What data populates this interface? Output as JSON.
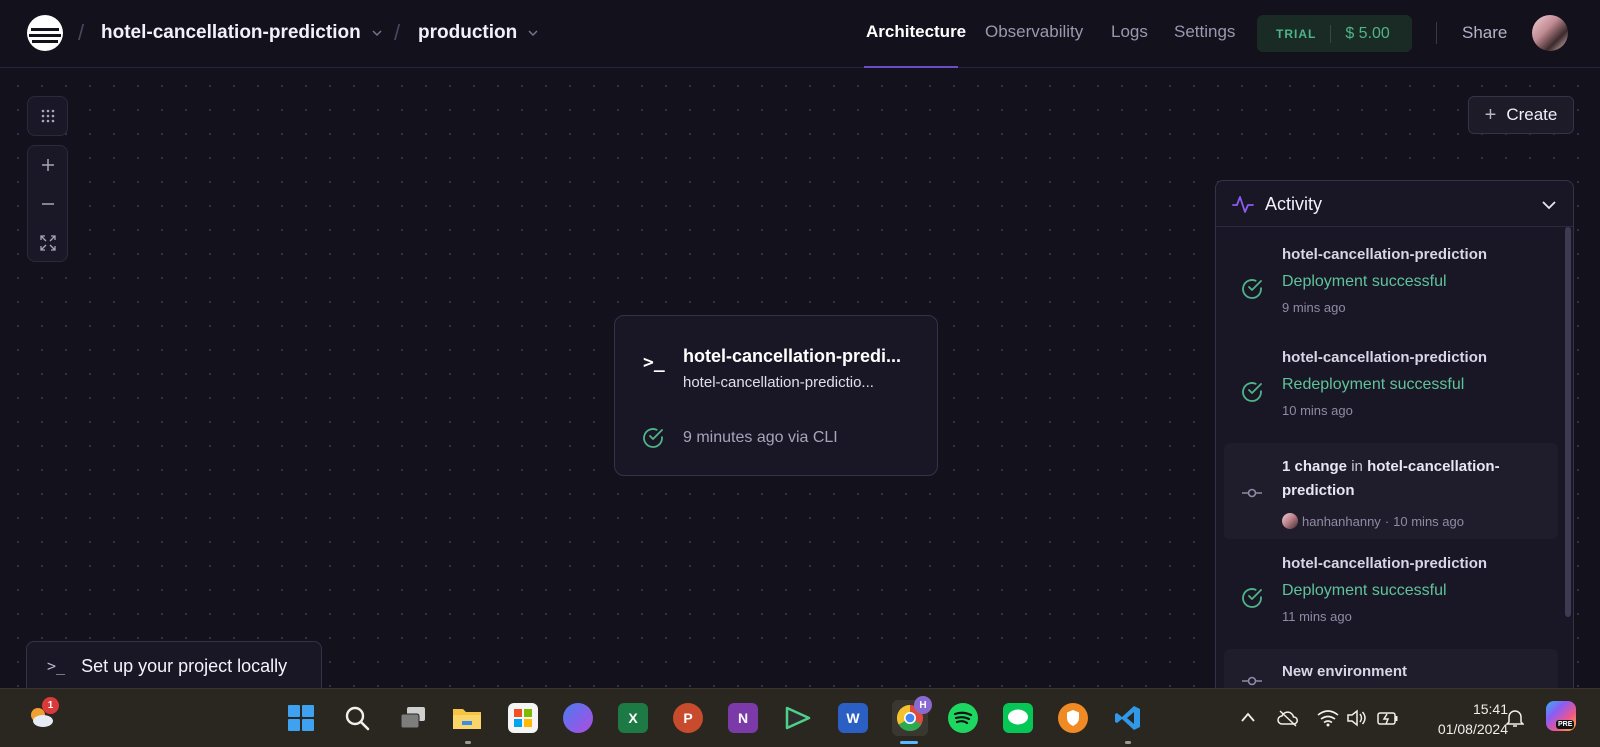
{
  "topbar": {
    "project": "hotel-cancellation-prediction",
    "environment": "production",
    "nav": [
      "Architecture",
      "Observability",
      "Logs",
      "Settings"
    ],
    "trial_label": "TRIAL",
    "trial_amount": "$ 5.00",
    "share_label": "Share"
  },
  "canvas": {
    "create_label": "Create",
    "setup_label": "Set up your project locally",
    "service": {
      "name": "hotel-cancellation-predi...",
      "subtitle": "hotel-cancellation-predictio...",
      "status": "9 minutes ago via CLI"
    }
  },
  "activity": {
    "title": "Activity",
    "items": [
      {
        "name": "hotel-cancellation-prediction",
        "status": "Deployment successful",
        "time": "9 mins ago"
      },
      {
        "name": "hotel-cancellation-prediction",
        "status": "Redeployment successful",
        "time": "10 mins ago"
      },
      {
        "change_count": "1 change",
        "change_in": "in",
        "change_target": "hotel-cancellation-prediction",
        "user": "hanhanhanny",
        "dot": "·",
        "time": "10 mins ago"
      },
      {
        "name": "hotel-cancellation-prediction",
        "status": "Deployment successful",
        "time": "11 mins ago"
      },
      {
        "name": "New environment"
      }
    ]
  },
  "taskbar": {
    "weather_badge": "1",
    "chrome_profile": "H",
    "time": "15:41",
    "date": "01/08/2024",
    "copilot_badge": "PRE"
  },
  "colors": {
    "background": "#13111c",
    "accent": "#6b4cc2",
    "success": "#5fc39a",
    "trial": "#4fb48a"
  }
}
